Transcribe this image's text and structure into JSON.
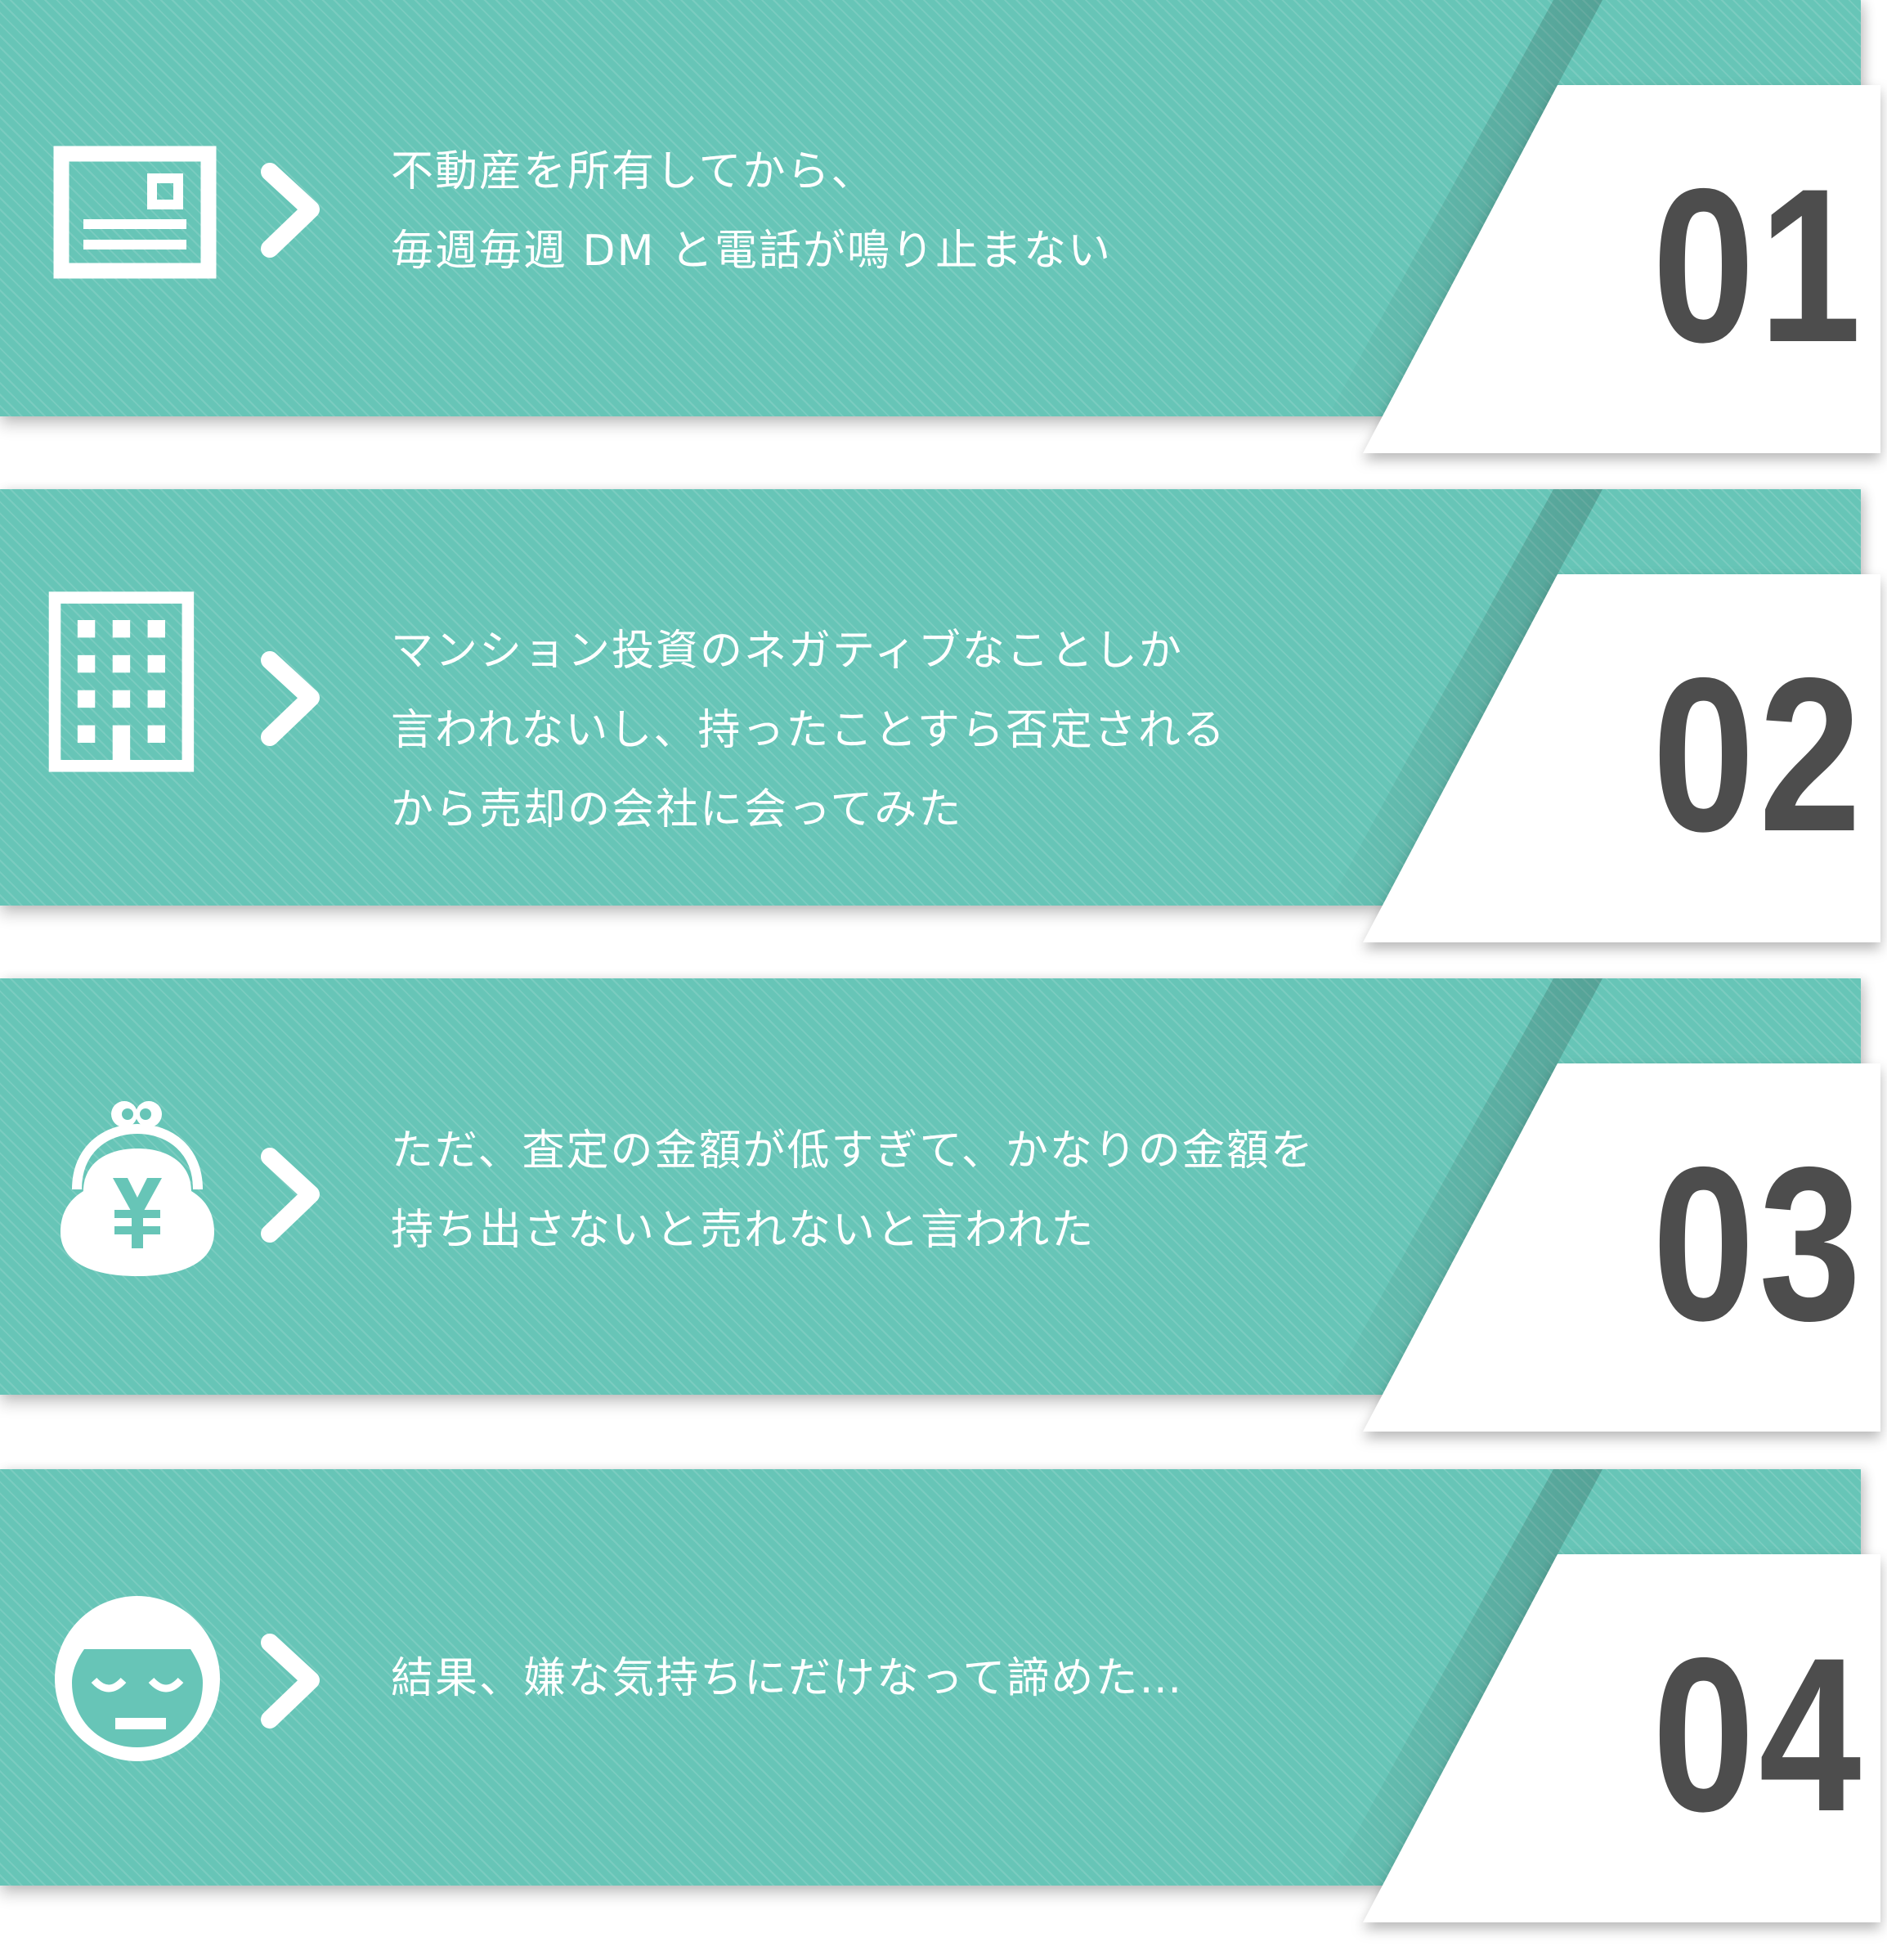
{
  "colors": {
    "teal": "#67c5b7",
    "card": "#ffffff",
    "number": "#4d4d4d",
    "text": "#ffffff"
  },
  "items": [
    {
      "number": "01",
      "icon": "postcard-icon",
      "lines": [
        "不動産を所有してから、",
        "毎週毎週 DM と電話が鳴り止まない"
      ]
    },
    {
      "number": "02",
      "icon": "building-icon",
      "lines": [
        "マンション投資のネガティブなことしか",
        "言われないし、持ったことすら否定される",
        "から売却の会社に会ってみた"
      ]
    },
    {
      "number": "03",
      "icon": "yen-purse-icon",
      "lines": [
        "ただ、査定の金額が低すぎて、かなりの金額を",
        "持ち出さないと売れないと言われた"
      ]
    },
    {
      "number": "04",
      "icon": "resigned-face-icon",
      "lines": [
        "結果、嫌な気持ちにだけなって諦めた…"
      ]
    }
  ]
}
